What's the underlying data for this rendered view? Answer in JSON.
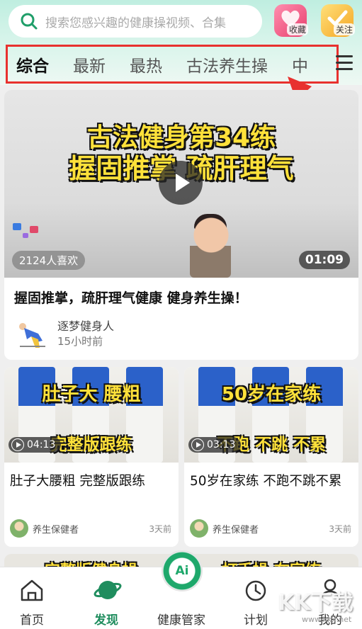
{
  "search": {
    "placeholder": "搜索您感兴趣的健康操视频、合集"
  },
  "top_actions": {
    "favorites_label": "收藏",
    "follow_label": "关注"
  },
  "tabs": [
    {
      "label": "综合",
      "active": true
    },
    {
      "label": "最新",
      "active": false
    },
    {
      "label": "最热",
      "active": false
    },
    {
      "label": "古法养生操",
      "active": false
    },
    {
      "label": "中",
      "active": false
    }
  ],
  "feature": {
    "caption_line1": "古法健身第34练",
    "caption_line2": "握固推掌 疏肝理气",
    "likes": "2124人喜欢",
    "duration": "01:09",
    "title": "握固推掌，疏肝理气健康 健身养生操！",
    "author": "逐梦健身人",
    "time": "15小时前"
  },
  "videos": [
    {
      "caption_top": "肚子大 腰粗",
      "caption_bottom": "完整版跟练",
      "duration": "04:13",
      "title": "肚子大腰粗 完整版跟练",
      "author": "养生保健者",
      "time": "3天前"
    },
    {
      "caption_top": "50岁在家练",
      "caption_bottom": "不跑 不跳 不累",
      "duration": "03:13",
      "title": "50岁在家练 不跑不跳不累",
      "author": "养生保健者",
      "time": "3天前"
    }
  ],
  "peek": {
    "left_caption": "完整版健身操",
    "right_caption": "打手操 在家练"
  },
  "bottom_nav": [
    {
      "label": "首页",
      "active": false,
      "icon": "home-icon"
    },
    {
      "label": "发现",
      "active": true,
      "icon": "planet-icon"
    },
    {
      "label": "健康管家",
      "active": false,
      "icon": "ai-icon",
      "badge": "Ai"
    },
    {
      "label": "计划",
      "active": false,
      "icon": "timer-icon"
    },
    {
      "label": "我的",
      "active": false,
      "icon": "user-icon"
    }
  ],
  "watermark": {
    "text": "KK下载",
    "url": "www.kkx.net"
  },
  "colors": {
    "accent_green": "#1f8d5e",
    "highlight_red": "#e8312f",
    "caption_yellow": "#ffe13a"
  }
}
